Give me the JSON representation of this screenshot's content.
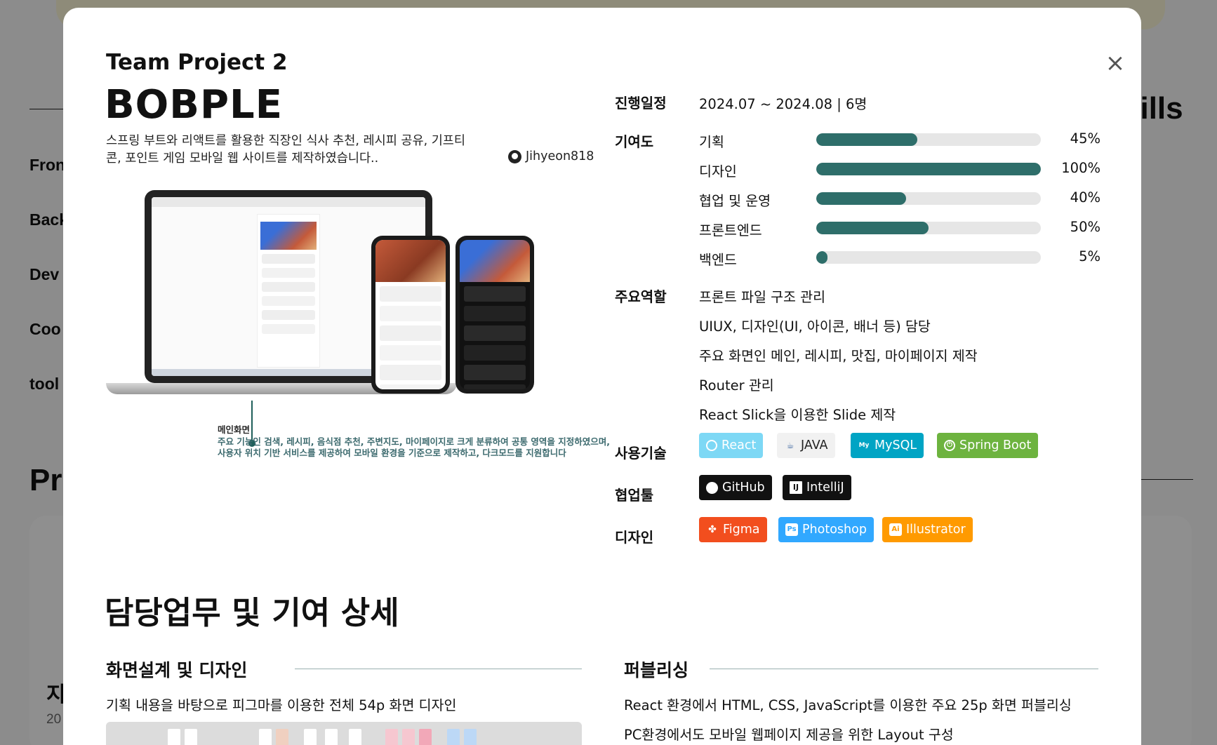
{
  "background": {
    "skills_heading": "kills",
    "categories": [
      "Fron",
      "Back",
      "Dev",
      "Coo",
      "tool"
    ],
    "projects_heading": "Pr",
    "card_title": "지",
    "card_date": "20"
  },
  "modal": {
    "close": "×",
    "subtitle": "Team Project 2",
    "title": "BOBPLE",
    "description": "스프링 부트와 리액트를 활용한 직장인 식사 추천, 레시피 공유, 기프티콘, 포인트 게임 모바일 웹 사이트를 제작하였습니다..",
    "github": "Jihyeon818",
    "caption_title": "메인화면",
    "caption_text": "주요 기능인 검색, 레시피, 음식점 추천, 주변지도, 마이페이지로 크게 분류하여 공통 영역을 지정하였으며, 사용자 위치 기반 서비스를 제공하여 모바일 환경을 기준으로 제작하고, 다크모드를 지원합니다",
    "schedule": {
      "label": "진행일정",
      "value": "2024.07 ~ 2024.08 | 6명"
    },
    "contribution": {
      "label": "기여도",
      "items": [
        {
          "name": "기획",
          "percent": 45,
          "text": "45%"
        },
        {
          "name": "디자인",
          "percent": 100,
          "text": "100%"
        },
        {
          "name": "협업 및 운영",
          "percent": 40,
          "text": "40%"
        },
        {
          "name": "프론트엔드",
          "percent": 50,
          "text": "50%"
        },
        {
          "name": "백엔드",
          "percent": 5,
          "text": "5%"
        }
      ]
    },
    "roles": {
      "label": "주요역할",
      "items": [
        "프론트 파일 구조 관리",
        "UIUX, 디자인(UI, 아이콘, 배너 등) 담당",
        "주요 화면인 메인, 레시피, 맛집, 마이페이지 제작",
        "Router 관리",
        "React Slick을 이용한 Slide 제작"
      ]
    },
    "tech": {
      "label": "사용기술",
      "items": [
        {
          "name": "React",
          "icon": "react-icon",
          "color": "#61dafb"
        },
        {
          "name": "JAVA",
          "icon": "java-icon",
          "color": "#f0f0f0"
        },
        {
          "name": "MySQL",
          "icon": "mysql-icon",
          "color": "#00a4c4"
        },
        {
          "name": "Spring Boot",
          "icon": "spring-boot-icon",
          "color": "#6db33f"
        }
      ]
    },
    "collab": {
      "label": "협업툴",
      "items": [
        {
          "name": "GitHub",
          "icon": "github-icon",
          "color": "#111111"
        },
        {
          "name": "IntelliJ",
          "icon": "intellij-icon",
          "color": "#111111"
        }
      ]
    },
    "design": {
      "label": "디자인",
      "items": [
        {
          "name": "Figma",
          "icon": "figma-icon",
          "color": "#f24e1e"
        },
        {
          "name": "Photoshop",
          "icon": "photoshop-icon",
          "color": "#31a8ff"
        },
        {
          "name": "Illustrator",
          "icon": "illustrator-icon",
          "color": "#ff9a00"
        }
      ]
    },
    "detail_title": "담당업무 및 기여 상세",
    "screen_design": {
      "title": "화면설계 및 디자인",
      "text": "기획 내용을 바탕으로 피그마를 이용한 전체 54p 화면 디자인"
    },
    "publishing": {
      "title": "퍼블리싱",
      "lines": [
        "React 환경에서 HTML, CSS, JavaScript를 이용한 주요 25p 화면 퍼블리싱",
        "PC환경에서도 모바일 웹페이지 제공을 위한 Layout 구성"
      ]
    }
  }
}
